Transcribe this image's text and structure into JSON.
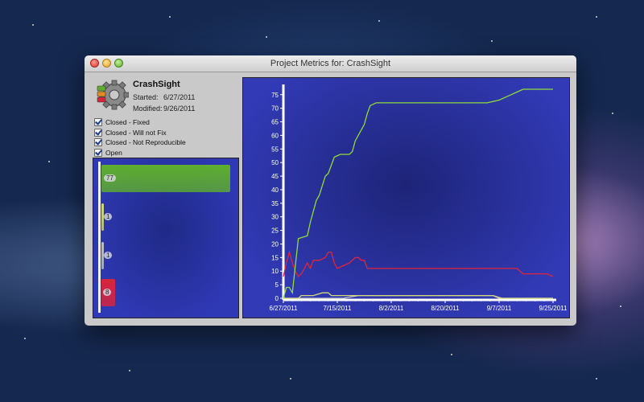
{
  "window": {
    "title": "Project Metrics for: CrashSight"
  },
  "project": {
    "name": "CrashSight",
    "started_label": "Started:",
    "started_value": "6/27/2011",
    "modified_label": "Modified:",
    "modified_value": "9/26/2011"
  },
  "filters": [
    {
      "label": "Closed - Fixed",
      "checked": true
    },
    {
      "label": "Closed - Will not Fix",
      "checked": true
    },
    {
      "label": "Closed - Not Reproducible",
      "checked": true
    },
    {
      "label": "Open",
      "checked": true
    }
  ],
  "summary_bars": [
    {
      "label": "77",
      "value": 77,
      "color": "#5fae2f"
    },
    {
      "label": "1",
      "value": 1,
      "color": "#d6d87a"
    },
    {
      "label": "1",
      "value": 1,
      "color": "#c0c0c0"
    },
    {
      "label": "8",
      "value": 8,
      "color": "#d9253a"
    }
  ],
  "chart_data": {
    "type": "line",
    "xlabel": "",
    "ylabel": "",
    "ylim": [
      0,
      77
    ],
    "x_tick_labels": [
      "6/27/2011",
      "7/15/2011",
      "8/2/2011",
      "8/20/2011",
      "9/7/2011",
      "9/25/2011"
    ],
    "y_ticks": [
      0,
      5,
      10,
      15,
      20,
      25,
      30,
      35,
      40,
      45,
      50,
      55,
      60,
      65,
      70,
      75
    ],
    "x_range_days": [
      0,
      90
    ],
    "grid": false,
    "series": [
      {
        "color": "#8fdc3a",
        "points": [
          [
            0,
            0
          ],
          [
            1,
            4
          ],
          [
            2,
            4
          ],
          [
            3,
            2
          ],
          [
            5,
            22
          ],
          [
            8,
            23
          ],
          [
            9,
            28
          ],
          [
            10,
            32
          ],
          [
            11,
            36
          ],
          [
            12,
            38
          ],
          [
            14,
            45
          ],
          [
            15,
            46
          ],
          [
            17,
            52
          ],
          [
            19,
            53
          ],
          [
            22,
            53
          ],
          [
            23,
            54
          ],
          [
            24,
            58
          ],
          [
            26,
            62
          ],
          [
            27,
            64
          ],
          [
            28,
            68
          ],
          [
            29,
            71
          ],
          [
            31,
            72
          ],
          [
            37,
            72
          ],
          [
            45,
            72
          ],
          [
            55,
            72
          ],
          [
            68,
            72
          ],
          [
            72,
            73
          ],
          [
            76,
            75
          ],
          [
            80,
            77
          ],
          [
            90,
            77
          ]
        ]
      },
      {
        "color": "#e0253a",
        "points": [
          [
            0,
            8
          ],
          [
            1,
            13
          ],
          [
            2,
            17
          ],
          [
            3,
            13
          ],
          [
            4,
            10
          ],
          [
            5,
            8
          ],
          [
            6,
            9
          ],
          [
            7,
            11
          ],
          [
            8,
            13
          ],
          [
            9,
            11
          ],
          [
            10,
            14
          ],
          [
            12,
            14
          ],
          [
            14,
            15
          ],
          [
            15,
            17
          ],
          [
            16,
            17
          ],
          [
            17,
            13
          ],
          [
            18,
            11
          ],
          [
            20,
            12
          ],
          [
            22,
            13
          ],
          [
            24,
            15
          ],
          [
            25,
            15
          ],
          [
            26,
            14
          ],
          [
            27,
            14
          ],
          [
            28,
            11
          ],
          [
            40,
            11
          ],
          [
            55,
            11
          ],
          [
            78,
            11
          ],
          [
            80,
            9
          ],
          [
            88,
            9
          ],
          [
            90,
            8
          ]
        ]
      },
      {
        "color": "#d6d87a",
        "points": [
          [
            0,
            0
          ],
          [
            5,
            0
          ],
          [
            6,
            1
          ],
          [
            10,
            1
          ],
          [
            13,
            2
          ],
          [
            15,
            2
          ],
          [
            16,
            1
          ],
          [
            20,
            1
          ],
          [
            24,
            1
          ],
          [
            30,
            1
          ],
          [
            40,
            1
          ],
          [
            60,
            1
          ],
          [
            70,
            1
          ],
          [
            72,
            0
          ],
          [
            90,
            0
          ]
        ]
      },
      {
        "color": "#c8c8c8",
        "points": [
          [
            0,
            0
          ],
          [
            20,
            0
          ],
          [
            25,
            1
          ],
          [
            28,
            1
          ],
          [
            30,
            1
          ],
          [
            35,
            1
          ],
          [
            50,
            1
          ],
          [
            65,
            1
          ],
          [
            70,
            1
          ],
          [
            73,
            0
          ],
          [
            90,
            0
          ]
        ]
      }
    ]
  }
}
